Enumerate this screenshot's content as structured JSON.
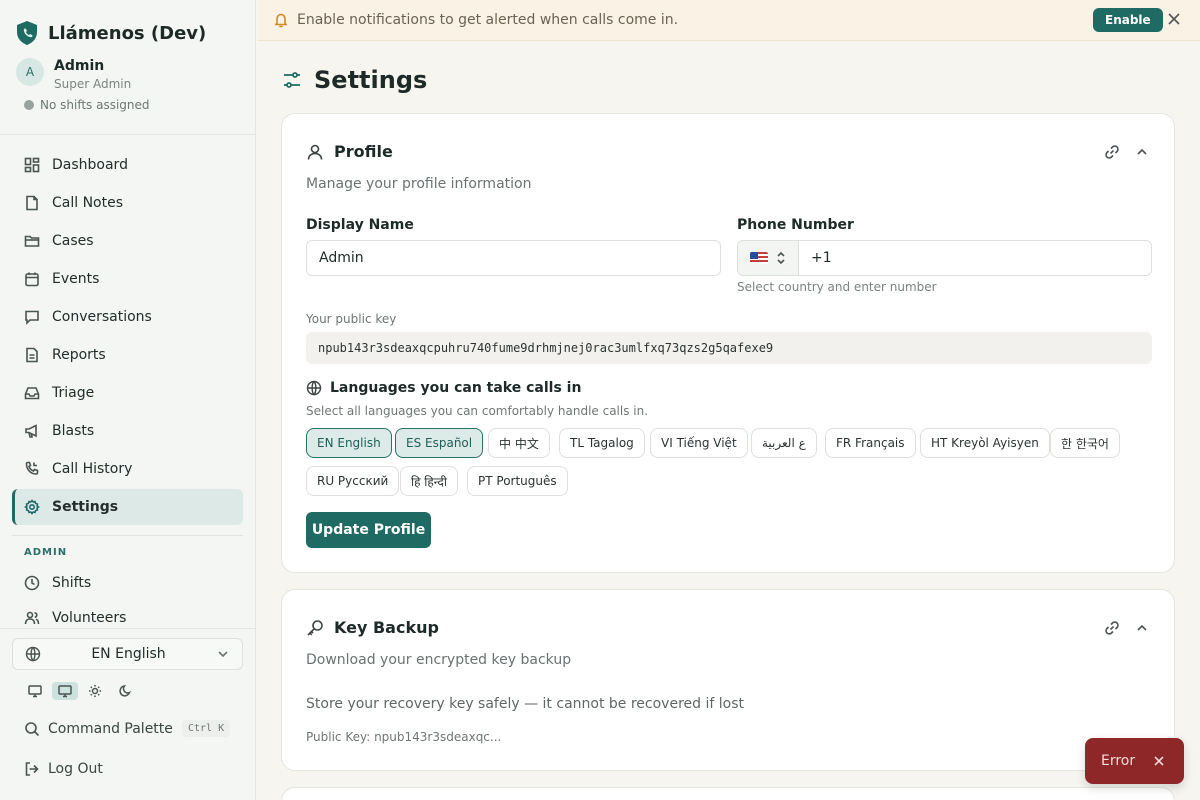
{
  "app": {
    "name": "Llámenos (Dev)"
  },
  "user": {
    "initial": "A",
    "name": "Admin",
    "role": "Super Admin",
    "shift_status": "No shifts assigned"
  },
  "nav": {
    "items": [
      {
        "label": "Dashboard",
        "icon": "dashboard-icon"
      },
      {
        "label": "Call Notes",
        "icon": "file-icon"
      },
      {
        "label": "Cases",
        "icon": "folder-icon"
      },
      {
        "label": "Events",
        "icon": "calendar-icon"
      },
      {
        "label": "Conversations",
        "icon": "chat-icon"
      },
      {
        "label": "Reports",
        "icon": "report-icon"
      },
      {
        "label": "Triage",
        "icon": "inbox-icon"
      },
      {
        "label": "Blasts",
        "icon": "megaphone-icon"
      },
      {
        "label": "Call History",
        "icon": "phone-icon"
      },
      {
        "label": "Settings",
        "icon": "gear-icon",
        "active": true
      }
    ],
    "admin_section": "ADMIN",
    "admin_items": [
      {
        "label": "Shifts",
        "icon": "clock-icon"
      },
      {
        "label": "Volunteers",
        "icon": "users-icon"
      }
    ]
  },
  "sidebar_bottom": {
    "language": "EN English",
    "command_palette": "Command Palette",
    "shortcut": "Ctrl K",
    "logout": "Log Out"
  },
  "banner": {
    "text": "Enable notifications to get alerted when calls come in.",
    "button": "Enable"
  },
  "page": {
    "title": "Settings"
  },
  "profile": {
    "title": "Profile",
    "subtitle": "Manage your profile information",
    "display_name_label": "Display Name",
    "display_name_value": "Admin",
    "phone_label": "Phone Number",
    "phone_value": "+1",
    "phone_hint": "Select country and enter number",
    "public_key_label": "Your public key",
    "public_key": "npub143r3sdeaxqcpuhru740fume9drhmjnej0rac3umlfxq73qzs2g5qafexe9",
    "languages_title": "Languages you can take calls in",
    "languages_subtitle": "Select all languages you can comfortably handle calls in.",
    "languages": [
      {
        "label": "EN English",
        "selected": true
      },
      {
        "label": "ES Español",
        "selected": true
      },
      {
        "label": "中 中文",
        "selected": false
      },
      {
        "label": "TL Tagalog",
        "selected": false
      },
      {
        "label": "VI Tiếng Việt",
        "selected": false
      },
      {
        "label": "ع العربية",
        "selected": false
      },
      {
        "label": "FR Français",
        "selected": false
      },
      {
        "label": "HT Kreyòl Ayisyen",
        "selected": false
      },
      {
        "label": "한 한국어",
        "selected": false
      },
      {
        "label": "RU Русский",
        "selected": false
      },
      {
        "label": "हि हिन्दी",
        "selected": false
      },
      {
        "label": "PT Português",
        "selected": false
      }
    ],
    "update_button": "Update Profile"
  },
  "key_backup": {
    "title": "Key Backup",
    "subtitle": "Download your encrypted key backup",
    "warning": "Store your recovery key safely — it cannot be recovered if lost",
    "public_key_short": "Public Key: npub143r3sdeaxqc..."
  },
  "toast": {
    "text": "Error"
  },
  "colors": {
    "accent": "#1f6b64",
    "banner_bg": "#fbf2e6",
    "toast_bg": "#8e2727"
  }
}
